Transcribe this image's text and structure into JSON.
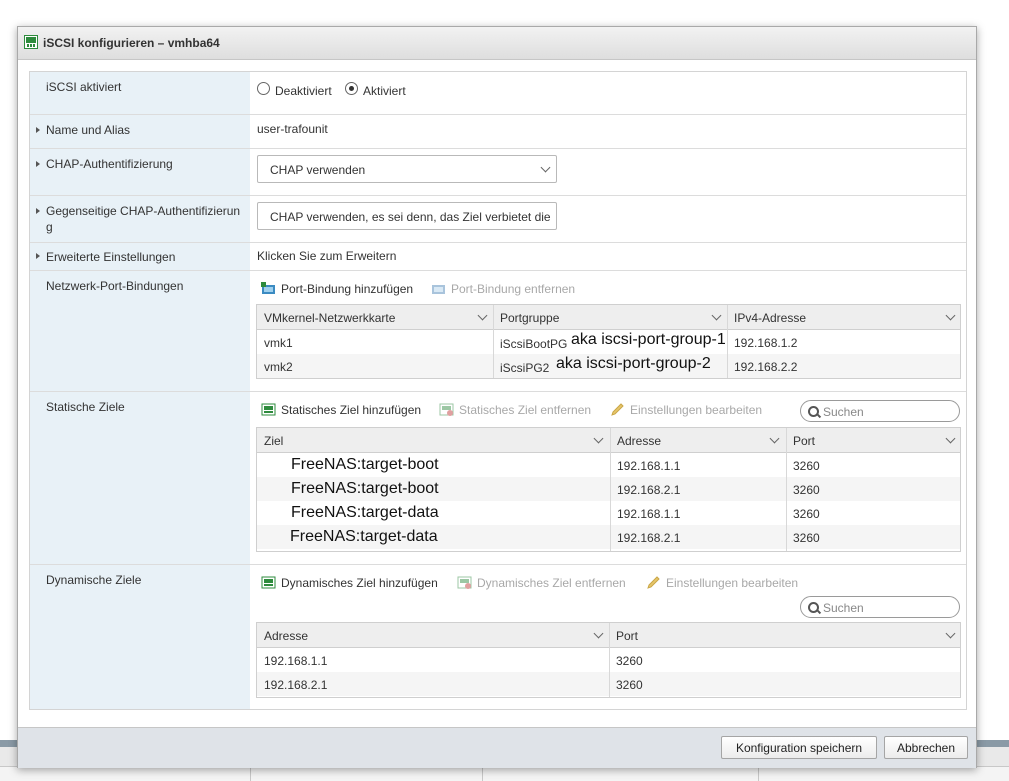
{
  "dialog": {
    "title": "iSCSI konfigurieren – vmhba64"
  },
  "rows": {
    "enabled": {
      "label": "iSCSI aktiviert",
      "option_disabled": "Deaktiviert",
      "option_enabled": "Aktiviert",
      "selected": "Aktiviert"
    },
    "name_alias": {
      "label": "Name und Alias",
      "value": "user-trafounit"
    },
    "chap": {
      "label": "CHAP-Authentifizierung",
      "value": "CHAP verwenden"
    },
    "mutual_chap": {
      "label": "Gegenseitige CHAP-Authentifizierung",
      "value": "CHAP verwenden, es sei denn, das Ziel verbietet die"
    },
    "advanced": {
      "label": "Erweiterte Einstellungen",
      "value": "Klicken Sie zum Erweitern"
    },
    "port_binding": {
      "label": "Netzwerk-Port-Bindungen",
      "add_label": "Port-Bindung hinzufügen",
      "remove_label": "Port-Bindung entfernen",
      "columns": [
        "VMkernel-Netzwerkkarte",
        "Portgruppe",
        "IPv4-Adresse"
      ],
      "rows": [
        {
          "nic": "vmk1",
          "group": "iScsiBootPG",
          "annotation": "aka iscsi-port-group-1",
          "ip": "192.168.1.2"
        },
        {
          "nic": "vmk2",
          "group": "iScsiPG2",
          "annotation": "aka iscsi-port-group-2",
          "ip": "192.168.2.2"
        }
      ]
    },
    "static_targets": {
      "label": "Statische Ziele",
      "add_label": "Statisches Ziel hinzufügen",
      "remove_label": "Statisches Ziel entfernen",
      "edit_label": "Einstellungen bearbeiten",
      "search_placeholder": "Suchen",
      "columns": [
        "Ziel",
        "Adresse",
        "Port"
      ],
      "rows": [
        {
          "target": "FreeNAS:target-boot",
          "address": "192.168.1.1",
          "port": "3260"
        },
        {
          "target": "FreeNAS:target-boot",
          "address": "192.168.2.1",
          "port": "3260"
        },
        {
          "target": "FreeNAS:target-data",
          "address": "192.168.1.1",
          "port": "3260"
        },
        {
          "target": "FreeNAS:target-data",
          "address": "192.168.2.1",
          "port": "3260"
        }
      ]
    },
    "dynamic_targets": {
      "label": "Dynamische Ziele",
      "add_label": "Dynamisches Ziel hinzufügen",
      "remove_label": "Dynamisches Ziel entfernen",
      "edit_label": "Einstellungen bearbeiten",
      "search_placeholder": "Suchen",
      "columns": [
        "Adresse",
        "Port"
      ],
      "rows": [
        {
          "address": "192.168.1.1",
          "port": "3260"
        },
        {
          "address": "192.168.2.1",
          "port": "3260"
        }
      ]
    }
  },
  "footer": {
    "save_label": "Konfiguration speichern",
    "cancel_label": "Abbrechen"
  },
  "colors": {
    "label_bg": "#e8f1f7",
    "icon_green": "#2e8b3d",
    "footer_bg": "#dfe3e8"
  }
}
